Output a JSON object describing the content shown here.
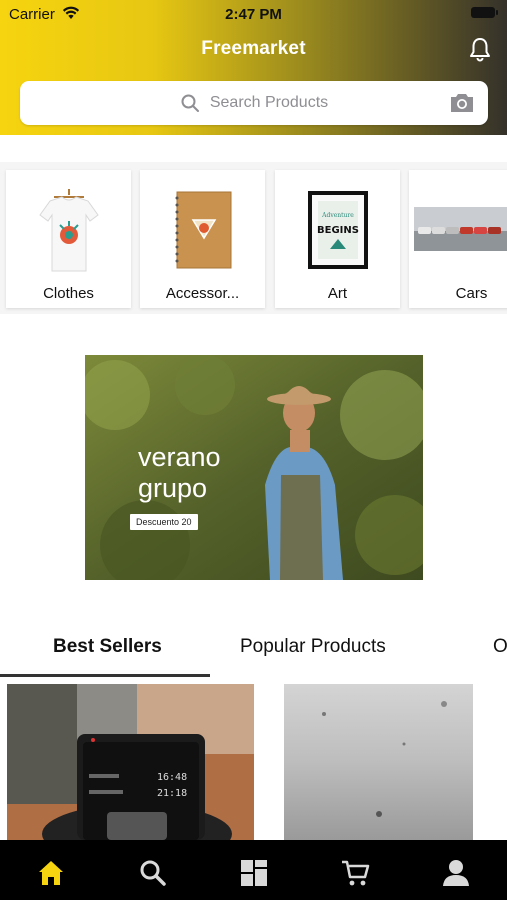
{
  "status_bar": {
    "carrier": "Carrier",
    "time": "2:47 PM"
  },
  "header": {
    "title": "Freemarket",
    "search_placeholder": "Search Products",
    "gradient_start": "#f6d410",
    "gradient_end": "#34312a"
  },
  "categories": [
    {
      "label": "Clothes",
      "image": "t-shirt"
    },
    {
      "label": "Accessor...",
      "image": "notebook"
    },
    {
      "label": "Art",
      "image": "framed-poster"
    },
    {
      "label": "Cars",
      "image": "cars-photo"
    }
  ],
  "banner": {
    "line1": "verano",
    "line2": "grupo",
    "tag": "Descuento 20"
  },
  "tabs": [
    "Best Sellers",
    "Popular Products",
    "O"
  ],
  "active_tab": "Best Sellers",
  "products": [
    {
      "image": "phone-on-charger-photo",
      "phone_time_1": "16:48",
      "phone_time_2": "21:18"
    },
    {
      "image": "grey-texture-photo"
    }
  ],
  "bottom_nav": [
    {
      "icon": "home-icon",
      "active": true
    },
    {
      "icon": "search-icon",
      "active": false
    },
    {
      "icon": "categories-icon",
      "active": false
    },
    {
      "icon": "cart-icon",
      "active": false
    },
    {
      "icon": "profile-icon",
      "active": false
    }
  ],
  "colors": {
    "accent": "#f6d410",
    "nav_bg": "#000000",
    "nav_icon": "#d9d9d9"
  }
}
